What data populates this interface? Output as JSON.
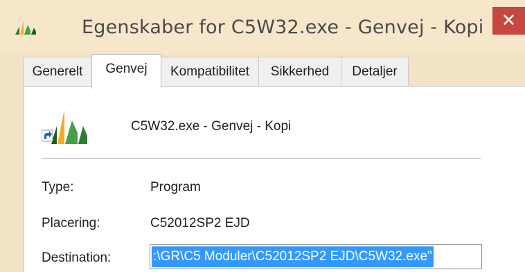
{
  "window": {
    "title": "Egenskaber for C5W32.exe - Genvej - Kopi",
    "close_glyph": "✕",
    "icon": "shortcut-app-icon"
  },
  "tabs": [
    {
      "label": "Generelt",
      "active": false
    },
    {
      "label": "Genvej",
      "active": true
    },
    {
      "label": "Kompatibilitet",
      "active": false
    },
    {
      "label": "Sikkerhed",
      "active": false
    },
    {
      "label": "Detaljer",
      "active": false
    }
  ],
  "shortcut": {
    "name": "C5W32.exe - Genvej - Kopi",
    "icon": "shortcut-app-icon"
  },
  "fields": {
    "type_label": "Type:",
    "type_value": "Program",
    "location_label": "Placering:",
    "location_value": "C52012SP2 EJD",
    "destination_label": "Destination:",
    "destination_value": ":\\GR\\C5 Moduler\\C52012SP2 EJD\\C5W32.exe\""
  },
  "colors": {
    "title_bar": "#f6e7cb",
    "close_button": "#c7463f",
    "selection": "#3399ff"
  }
}
